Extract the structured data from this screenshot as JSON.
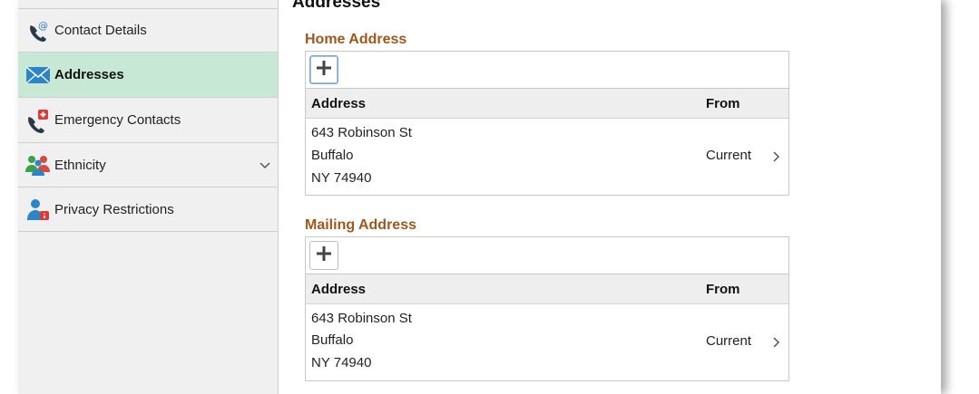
{
  "sidebar": {
    "items": [
      {
        "label": "Contact Details",
        "icon": "phone-at-icon",
        "active": false
      },
      {
        "label": "Addresses",
        "icon": "envelope-icon",
        "active": true
      },
      {
        "label": "Emergency Contacts",
        "icon": "emergency-phone-icon",
        "active": false
      },
      {
        "label": "Ethnicity",
        "icon": "people-group-icon",
        "active": false,
        "expandable": true
      },
      {
        "label": "Privacy Restrictions",
        "icon": "user-lock-icon",
        "active": false
      }
    ]
  },
  "main": {
    "title": "Addresses",
    "sections": [
      {
        "title": "Home Address",
        "add_icon": "plus-icon",
        "columns": [
          "Address",
          "From"
        ],
        "rows": [
          {
            "address": [
              "643 Robinson St",
              "Buffalo",
              "NY 74940"
            ],
            "from": "Current"
          }
        ]
      },
      {
        "title": "Mailing Address",
        "add_icon": "plus-icon",
        "columns": [
          "Address",
          "From"
        ],
        "rows": [
          {
            "address": [
              "643 Robinson St",
              "Buffalo",
              "NY 74940"
            ],
            "from": "Current"
          }
        ]
      }
    ]
  },
  "colors": {
    "accent_section_title": "#a0571c",
    "active_nav_bg": "#c8e8d6",
    "sidebar_bg": "#f0f0f0"
  }
}
